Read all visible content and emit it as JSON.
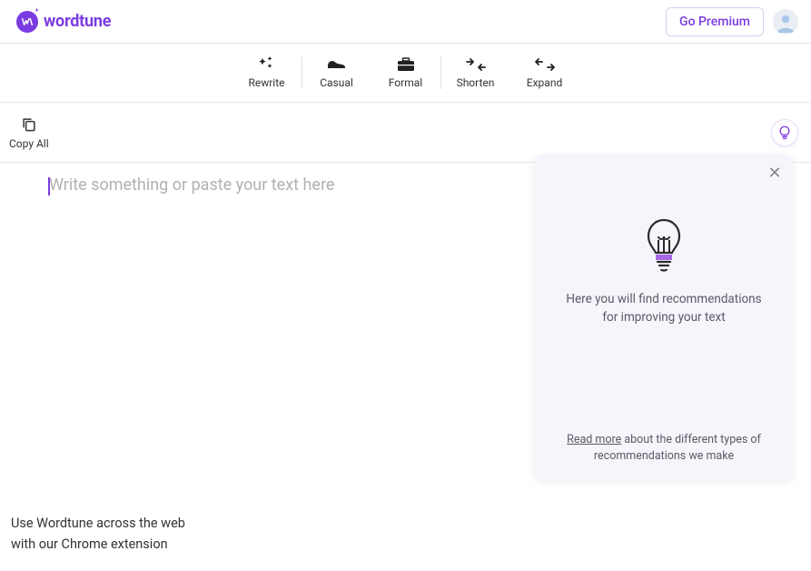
{
  "header": {
    "brand": "wordtune",
    "premium_button": "Go Premium"
  },
  "toolbar": {
    "items": [
      {
        "label": "Rewrite"
      },
      {
        "label": "Casual"
      },
      {
        "label": "Formal"
      },
      {
        "label": "Shorten"
      },
      {
        "label": "Expand"
      }
    ]
  },
  "subbar": {
    "copy_all": "Copy All"
  },
  "editor": {
    "placeholder": "Write something or paste your text here"
  },
  "panel": {
    "message_line1": "Here you will find recommendations",
    "message_line2": "for improving your text",
    "read_more": "Read more",
    "footer_rest": " about the different types of recommendations we make"
  },
  "footer": {
    "line1": "Use Wordtune across the web",
    "line2": "with our Chrome extension"
  }
}
